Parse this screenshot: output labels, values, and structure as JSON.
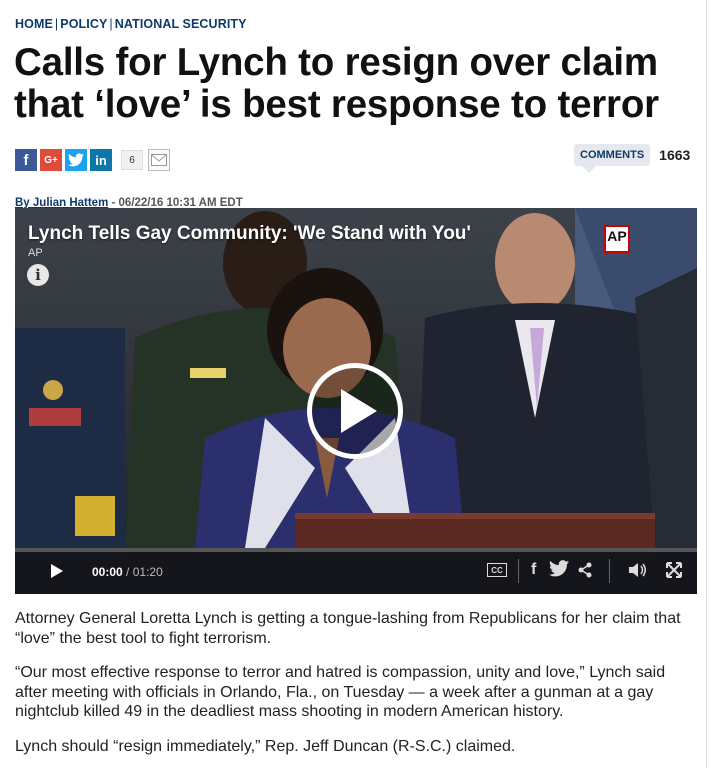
{
  "breadcrumb": {
    "home": "HOME",
    "policy": "POLICY",
    "section": "NATIONAL SECURITY"
  },
  "headline": "Calls for Lynch to resign over claim that ‘love’ is best response to terror",
  "share": {
    "count": "6",
    "icons": [
      "facebook-icon",
      "google-plus-icon",
      "twitter-icon",
      "linkedin-icon",
      "mail-icon"
    ]
  },
  "comments": {
    "label": "COMMENTS",
    "count": "1663"
  },
  "byline": {
    "author": "By Julian Hattem",
    "dateline": " - 06/22/16 10:31 AM EDT"
  },
  "video": {
    "title": "Lynch Tells Gay Community: 'We Stand with You'",
    "source": "AP",
    "logo": "AP",
    "info_glyph": "i",
    "current_time": "00:00",
    "duration": "/ 01:20",
    "cc_label": "CC",
    "progress": 0,
    "controls": [
      "play-icon",
      "cc-icon",
      "facebook-icon",
      "twitter-icon",
      "share-icon",
      "volume-icon",
      "fullscreen-icon"
    ]
  },
  "article": {
    "paragraphs": [
      "Attorney General Loretta Lynch is getting a tongue-lashing from Republicans for her claim that “love” the best tool to fight terrorism.",
      "“Our most effective response to terror and hatred is compassion, unity and love,” Lynch said after meeting with officials in Orlando, Fla., on Tuesday — a week after a gunman at a gay nightclub killed 49 in the deadliest mass shooting in modern American history.",
      "Lynch should “resign immediately,” Rep. Jeff Duncan (R-S.C.) claimed."
    ]
  },
  "colors": {
    "nav": "#0d3a6b",
    "facebook": "#3b5998",
    "google_plus": "#dd4b39",
    "twitter": "#1da1f2",
    "linkedin": "#0e76a8",
    "ap_red": "#cc0000"
  }
}
